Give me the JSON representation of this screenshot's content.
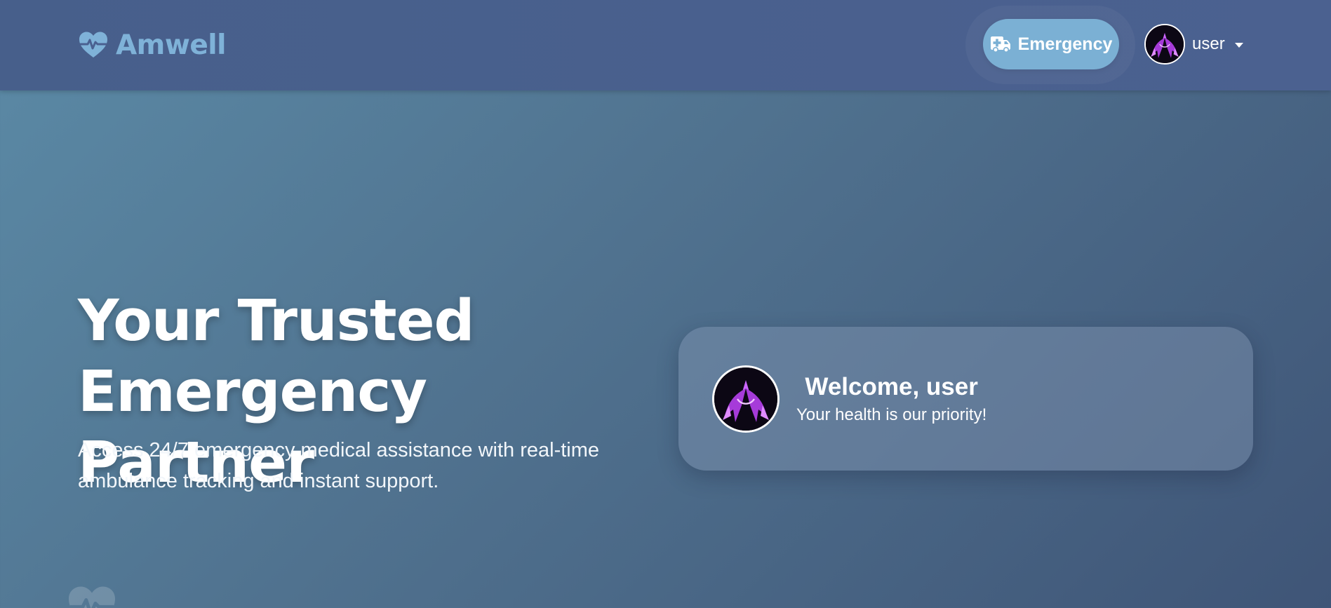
{
  "navbar": {
    "brand_name": "Amwell",
    "brand_icon": "heart-pulse-icon",
    "emergency_label": "Emergency",
    "emergency_icon": "ambulance-icon",
    "user_label": "user"
  },
  "hero": {
    "title_line1": "Your Trusted",
    "title_line2": "Emergency Partner",
    "subtitle_line1": "Access 24/7 emergency medical assistance with real-time",
    "subtitle_line2": "ambulance tracking and instant support."
  },
  "welcome_card": {
    "heading": "Welcome, user",
    "message": "Your health is our priority!"
  },
  "colors": {
    "navbar": "#475f8b",
    "brand": "#7fb2d8",
    "emergency_button": "#7bb0d4",
    "text": "#ffffff"
  }
}
